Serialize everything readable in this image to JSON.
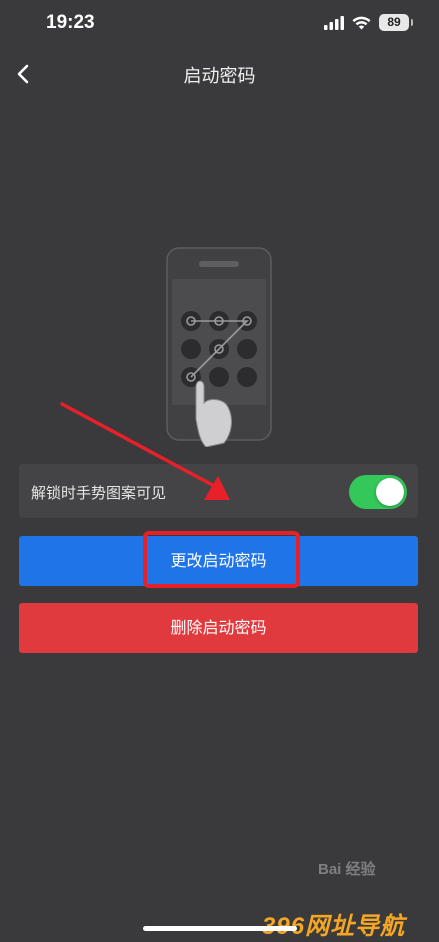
{
  "status_bar": {
    "time": "19:23",
    "battery": "89",
    "signal_icon": "cellular-signal-icon",
    "wifi_icon": "wifi-icon",
    "battery_icon": "battery-icon"
  },
  "nav": {
    "back_icon": "chevron-left-icon",
    "title": "启动密码"
  },
  "illustration": {
    "icon": "pattern-lock-phone-illustration"
  },
  "toggle": {
    "label": "解锁时手势图案可见",
    "on": true,
    "on_color": "#34c759"
  },
  "buttons": {
    "change_label": "更改启动密码",
    "change_color": "#1f74e8",
    "delete_label": "删除启动密码",
    "delete_color": "#e0393e"
  },
  "annotation": {
    "highlight_color": "#e8202a"
  },
  "watermarks": {
    "baidu": "Bai 经验",
    "site": "396网址导航"
  }
}
